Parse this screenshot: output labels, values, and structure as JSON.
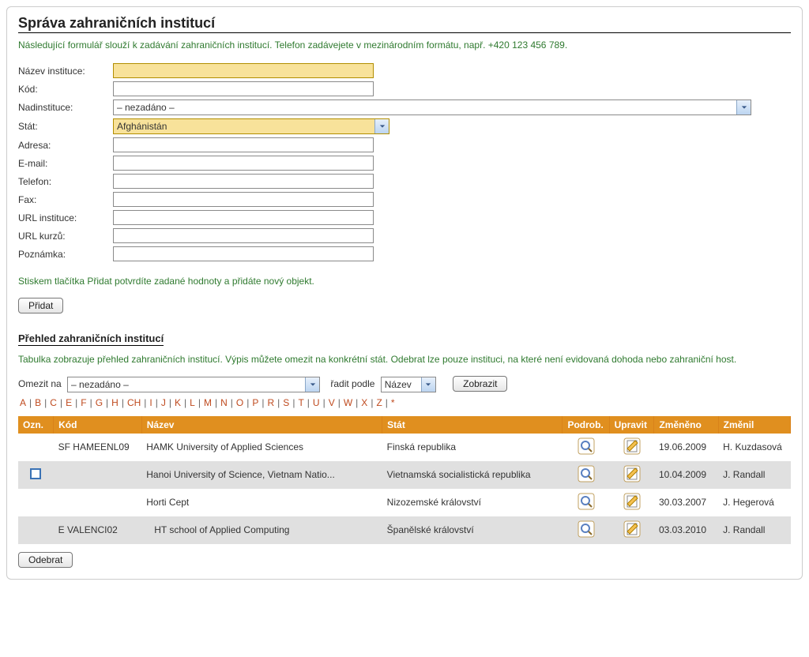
{
  "title": "Správa zahraničních institucí",
  "intro_text": "Následující formulář slouží k zadávání zahraničních institucí. Telefon zadávejete v mezinárodním formátu, např. +420 123 456 789.",
  "form": {
    "labels": {
      "nazev": "Název instituce:",
      "kod": "Kód:",
      "nadinstituce": "Nadinstituce:",
      "stat": "Stát:",
      "adresa": "Adresa:",
      "email": "E-mail:",
      "telefon": "Telefon:",
      "fax": "Fax:",
      "url_instituce": "URL instituce:",
      "url_kurzu": "URL kurzů:",
      "poznamka": "Poznámka:"
    },
    "values": {
      "nazev": "",
      "kod": "",
      "nadinstituce": "– nezadáno –",
      "stat": "Afghánistán",
      "adresa": "",
      "email": "",
      "telefon": "",
      "fax": "",
      "url_instituce": "",
      "url_kurzu": "",
      "poznamka": ""
    },
    "submit_hint": "Stiskem tlačítka Přidat potvrdíte zadané hodnoty a přidáte nový objekt.",
    "submit_label": "Přidat"
  },
  "overview": {
    "heading": "Přehled zahraničních institucí",
    "description": "Tabulka zobrazuje přehled zahraničních institucí. Výpis můžete omezit na konkrétní stát. Odebrat lze pouze instituci, na které není evidovaná dohoda nebo zahraniční host.",
    "filter": {
      "limit_label": "Omezit na",
      "limit_value": "– nezadáno –",
      "sort_label": "řadit podle",
      "sort_value": "Název",
      "show_label": "Zobrazit"
    },
    "alpha": [
      "A",
      "B",
      "C",
      "E",
      "F",
      "G",
      "H",
      "CH",
      "I",
      "J",
      "K",
      "L",
      "M",
      "N",
      "O",
      "P",
      "R",
      "S",
      "T",
      "U",
      "V",
      "W",
      "X",
      "Z",
      "*"
    ],
    "columns": {
      "ozn": "Ozn.",
      "kod": "Kód",
      "nazev": "Název",
      "stat": "Stát",
      "podrob": "Podrob.",
      "upravit": "Upravit",
      "zmeneno": "Změněno",
      "zmenil": "Změnil"
    },
    "rows": [
      {
        "ozn_checkbox": false,
        "kod": "SF HAMEENL09",
        "nazev": "HAMK University of Applied Sciences",
        "stat": "Finská republika",
        "zmeneno": "19.06.2009",
        "zmenil": "H. Kuzdasová"
      },
      {
        "ozn_checkbox": true,
        "kod": "",
        "nazev": "Hanoi University of Science, Vietnam Natio...",
        "stat": "Vietnamská socialistická republika",
        "zmeneno": "10.04.2009",
        "zmenil": "J. Randall"
      },
      {
        "ozn_checkbox": false,
        "kod": "",
        "nazev": "Horti Cept",
        "stat": "Nizozemské království",
        "zmeneno": "30.03.2007",
        "zmenil": "J. Hegerová"
      },
      {
        "ozn_checkbox": false,
        "kod": "E VALENCI02",
        "nazev": "   HT school of Applied Computing",
        "stat": "Španělské království",
        "zmeneno": "03.03.2010",
        "zmenil": "J. Randall"
      }
    ],
    "remove_label": "Odebrat"
  }
}
